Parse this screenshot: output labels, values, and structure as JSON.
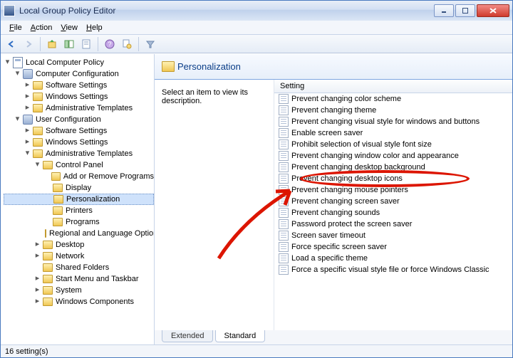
{
  "window_title": "Local Group Policy Editor",
  "menus": {
    "file": "File",
    "action": "Action",
    "view": "View",
    "help": "Help"
  },
  "tree": [
    {
      "depth": 0,
      "tw": "open",
      "icon": "root",
      "label": "Local Computer Policy"
    },
    {
      "depth": 1,
      "tw": "open",
      "icon": "gear",
      "label": "Computer Configuration"
    },
    {
      "depth": 2,
      "tw": "closed",
      "icon": "folder",
      "label": "Software Settings"
    },
    {
      "depth": 2,
      "tw": "closed",
      "icon": "folder",
      "label": "Windows Settings"
    },
    {
      "depth": 2,
      "tw": "closed",
      "icon": "folder",
      "label": "Administrative Templates"
    },
    {
      "depth": 1,
      "tw": "open",
      "icon": "gear",
      "label": "User Configuration"
    },
    {
      "depth": 2,
      "tw": "closed",
      "icon": "folder",
      "label": "Software Settings"
    },
    {
      "depth": 2,
      "tw": "closed",
      "icon": "folder",
      "label": "Windows Settings"
    },
    {
      "depth": 2,
      "tw": "open",
      "icon": "folder",
      "label": "Administrative Templates"
    },
    {
      "depth": 3,
      "tw": "open",
      "icon": "folder",
      "label": "Control Panel"
    },
    {
      "depth": 4,
      "tw": "",
      "icon": "folder",
      "label": "Add or Remove Programs"
    },
    {
      "depth": 4,
      "tw": "",
      "icon": "folder",
      "label": "Display"
    },
    {
      "depth": 4,
      "tw": "",
      "icon": "folder",
      "label": "Personalization",
      "selected": true
    },
    {
      "depth": 4,
      "tw": "",
      "icon": "folder",
      "label": "Printers"
    },
    {
      "depth": 4,
      "tw": "",
      "icon": "folder",
      "label": "Programs"
    },
    {
      "depth": 4,
      "tw": "",
      "icon": "folder",
      "label": "Regional and Language Options"
    },
    {
      "depth": 3,
      "tw": "closed",
      "icon": "folder",
      "label": "Desktop"
    },
    {
      "depth": 3,
      "tw": "closed",
      "icon": "folder",
      "label": "Network"
    },
    {
      "depth": 3,
      "tw": "",
      "icon": "folder",
      "label": "Shared Folders"
    },
    {
      "depth": 3,
      "tw": "closed",
      "icon": "folder",
      "label": "Start Menu and Taskbar"
    },
    {
      "depth": 3,
      "tw": "closed",
      "icon": "folder",
      "label": "System"
    },
    {
      "depth": 3,
      "tw": "closed",
      "icon": "folder",
      "label": "Windows Components"
    }
  ],
  "content_title": "Personalization",
  "desc_prompt": "Select an item to view its description.",
  "setting_header": "Setting",
  "settings": [
    "Prevent changing color scheme",
    "Prevent changing theme",
    "Prevent changing visual style for windows and buttons",
    "Enable screen saver",
    "Prohibit selection of visual style font size",
    "Prevent changing window color and appearance",
    "Prevent changing desktop background",
    "Prevent changing desktop icons",
    "Prevent changing mouse pointers",
    "Prevent changing screen saver",
    "Prevent changing sounds",
    "Password protect the screen saver",
    "Screen saver timeout",
    "Force specific screen saver",
    "Load a specific theme",
    "Force a specific visual style file or force Windows Classic"
  ],
  "tabs": {
    "extended": "Extended",
    "standard": "Standard"
  },
  "status_text": "16 setting(s)",
  "highlight_index": 6
}
